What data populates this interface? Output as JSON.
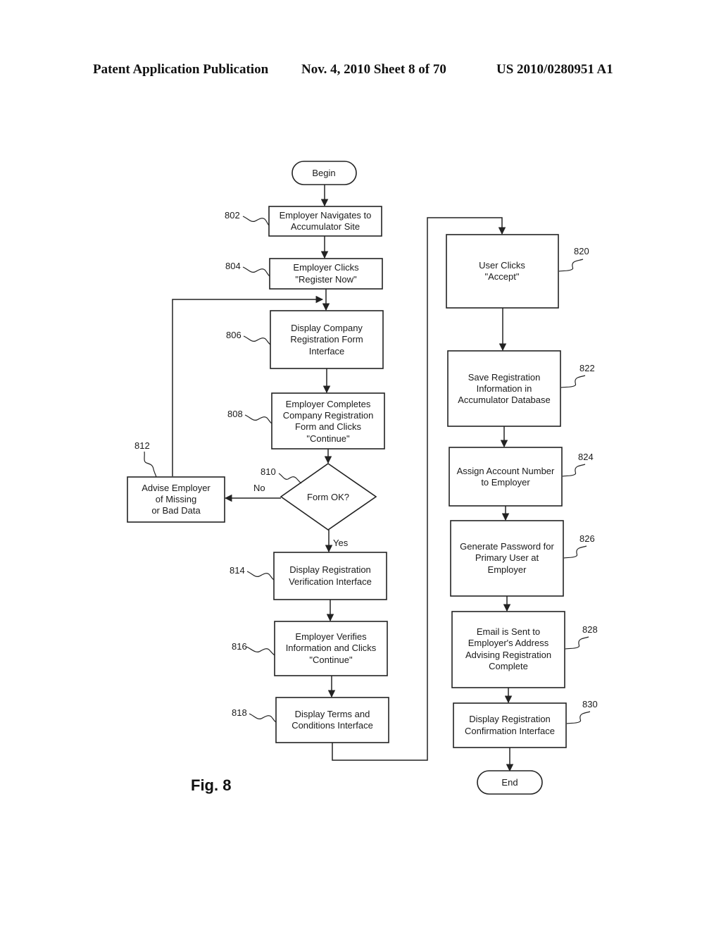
{
  "header": {
    "left": "Patent Application Publication",
    "middle": "Nov. 4, 2010   Sheet 8 of 70",
    "right": "US 2010/0280951 A1"
  },
  "figure_label": "Fig. 8",
  "nodes": {
    "begin": {
      "type": "terminal",
      "lines": [
        "Begin"
      ]
    },
    "n802": {
      "ref": "802",
      "type": "process",
      "lines": [
        "Employer Navigates to",
        "Accumulator Site"
      ]
    },
    "n804": {
      "ref": "804",
      "type": "process",
      "lines": [
        "Employer Clicks",
        "\"Register Now\""
      ]
    },
    "n806": {
      "ref": "806",
      "type": "process",
      "lines": [
        "Display Company",
        "Registration Form",
        "Interface"
      ]
    },
    "n808": {
      "ref": "808",
      "type": "process",
      "lines": [
        "Employer Completes",
        "Company Registration",
        "Form and Clicks",
        "\"Continue\""
      ]
    },
    "n810": {
      "ref": "810",
      "type": "decision",
      "lines": [
        "Form OK?"
      ]
    },
    "n812": {
      "ref": "812",
      "type": "process",
      "lines": [
        "Advise Employer",
        "of Missing",
        "or Bad Data"
      ]
    },
    "n814": {
      "ref": "814",
      "type": "process",
      "lines": [
        "Display Registration",
        "Verification Interface"
      ]
    },
    "n816": {
      "ref": "816",
      "type": "process",
      "lines": [
        "Employer Verifies",
        "Information and Clicks",
        "\"Continue\""
      ]
    },
    "n818": {
      "ref": "818",
      "type": "process",
      "lines": [
        "Display Terms and",
        "Conditions Interface"
      ]
    },
    "n820": {
      "ref": "820",
      "type": "process",
      "lines": [
        "User Clicks",
        "\"Accept\""
      ]
    },
    "n822": {
      "ref": "822",
      "type": "process",
      "lines": [
        "Save Registration",
        "Information in",
        "Accumulator Database"
      ]
    },
    "n824": {
      "ref": "824",
      "type": "process",
      "lines": [
        "Assign Account Number",
        "to Employer"
      ]
    },
    "n826": {
      "ref": "826",
      "type": "process",
      "lines": [
        "Generate Password for",
        "Primary User at",
        "Employer"
      ]
    },
    "n828": {
      "ref": "828",
      "type": "process",
      "lines": [
        "Email is Sent to",
        "Employer's Address",
        "Advising Registration",
        "Complete"
      ]
    },
    "n830": {
      "ref": "830",
      "type": "process",
      "lines": [
        "Display Registration",
        "Confirmation Interface"
      ]
    },
    "end": {
      "type": "terminal",
      "lines": [
        "End"
      ]
    }
  },
  "edge_labels": {
    "no": "No",
    "yes": "Yes"
  },
  "edges": [
    [
      "begin",
      "n802"
    ],
    [
      "n802",
      "n804"
    ],
    [
      "n804",
      "n806"
    ],
    [
      "n806",
      "n808"
    ],
    [
      "n808",
      "n810"
    ],
    [
      "n810",
      "n812",
      "No"
    ],
    [
      "n812",
      "n806"
    ],
    [
      "n810",
      "n814",
      "Yes"
    ],
    [
      "n814",
      "n816"
    ],
    [
      "n816",
      "n818"
    ],
    [
      "n818",
      "n820"
    ],
    [
      "n820",
      "n822"
    ],
    [
      "n822",
      "n824"
    ],
    [
      "n824",
      "n826"
    ],
    [
      "n826",
      "n828"
    ],
    [
      "n828",
      "n830"
    ],
    [
      "n830",
      "end"
    ]
  ]
}
